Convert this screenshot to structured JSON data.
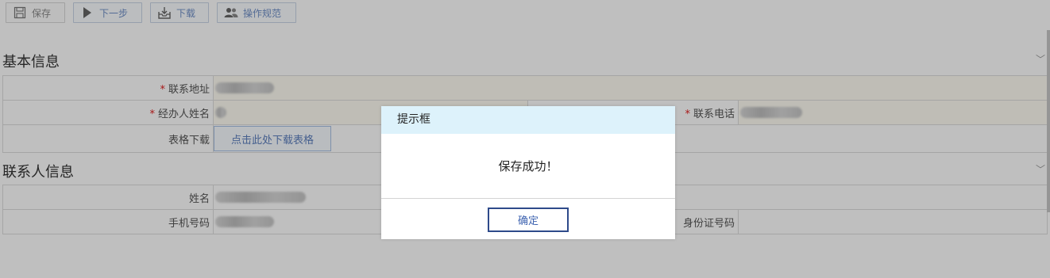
{
  "toolbar": {
    "save_label": "保存",
    "next_label": "下一步",
    "download_label": "下载",
    "spec_label": "操作规范",
    "icons": {
      "save": "floppy-disk-icon",
      "next": "play-arrow-icon",
      "download": "inbox-download-icon",
      "spec": "users-icon"
    }
  },
  "basic_info": {
    "title": "基本信息",
    "contact_address_label": "联系地址",
    "agent_name_label": "经办人姓名",
    "phone_label": "联系电话",
    "form_download_label": "表格下载",
    "form_download_button": "点击此处下载表格"
  },
  "contact_info": {
    "title": "联系人信息",
    "name_label": "姓名",
    "mobile_label": "手机号码",
    "id_number_label": "身份证号码"
  },
  "required_mark": "*",
  "dialog": {
    "title": "提示框",
    "message": "保存成功！",
    "ok_label": "确定"
  },
  "colors": {
    "dialog_header": "#ddf2fb",
    "required": "#e02020",
    "link_blue": "#5d7fbe",
    "ok_border": "#2e4a8a"
  }
}
